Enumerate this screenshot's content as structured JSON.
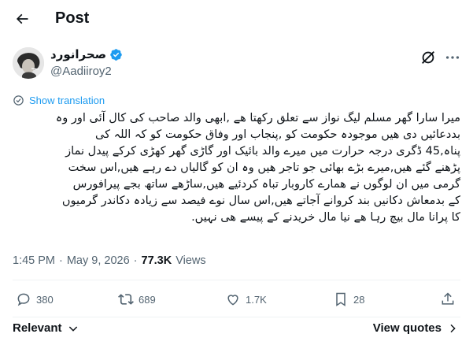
{
  "header": {
    "title": "Post"
  },
  "author": {
    "display_name": "صحرانورد",
    "handle": "@Aadiiroy2"
  },
  "translate": {
    "label": "Show translation"
  },
  "tweet": {
    "lines": [
      "میرا سارا گھر مسلم لیگ نواز سے تعلق رکھتا ھے ,ابھی والد صاحب کی کال آئی اور وہ",
      "بددعائیں دی ھیں موجودہ حکومت کو ,پنجاب اور وفاق حکومت کو کہ اللہ کی",
      "پناہ,45 ڈگری درجہ حرارت میں میرے والد بائیک اور گاڑی گھر کھڑی کرکے پیدل نماز",
      "پڑھنے گئے ھیں,میرے بڑے بھائی جو تاجر ھیں وہ ان کو گالیاں دے رہے ھیں,اس سخت",
      "گرمی میں ان لوگوں نے ھمارے کاروبار تباہ کردئیے ھیں,ساڑھے ساتھ بجے پیرافورس",
      "کے بدمعاش دکانیں بند کروانے آجاتے ھیں,اس سال نوے فیصد سے زیادہ دکاندر گرمیوں",
      "کا پرانا مال بیچ رہا ھے نیا مال خریدنے کے پیسے ھی نہیں."
    ]
  },
  "meta": {
    "time": "1:45 PM",
    "separator": "·",
    "date": "May 9, 2026",
    "views_count": "77.3K",
    "views_label": "Views"
  },
  "actions": {
    "replies": "380",
    "reposts": "689",
    "likes": "1.7K",
    "bookmarks": "28"
  },
  "footer": {
    "sort_label": "Relevant",
    "view_quotes_label": "View quotes"
  },
  "colors": {
    "accent": "#1d9bf0",
    "secondary_text": "#536471",
    "verified": "#1d9bf0"
  }
}
